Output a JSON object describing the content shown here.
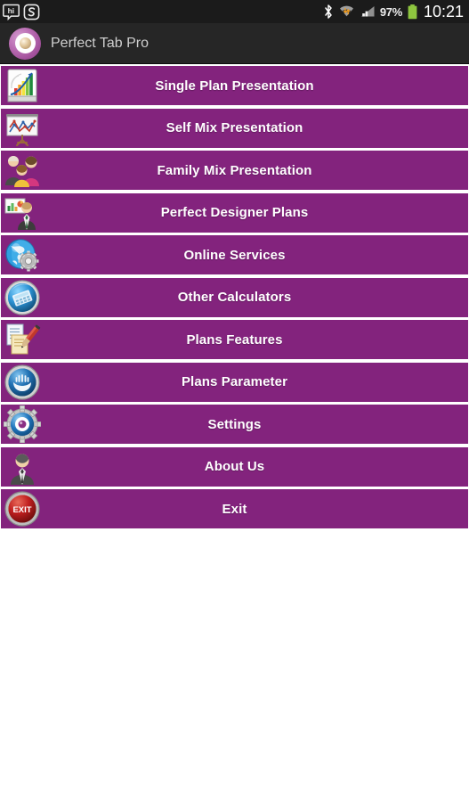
{
  "statusbar": {
    "left_icons": [
      {
        "name": "hike-messenger-icon",
        "label": "hi"
      },
      {
        "name": "notification-app-icon",
        "label": "S"
      }
    ],
    "right_icons": [
      {
        "name": "bluetooth-icon"
      },
      {
        "name": "wifi-icon"
      },
      {
        "name": "cellular-signal-icon"
      }
    ],
    "battery_percent": "97%",
    "battery_color": "#8ec63f",
    "clock": "10:21"
  },
  "titlebar": {
    "app_name": "Perfect Tab Pro",
    "logo_name": "app-logo-icon"
  },
  "theme": {
    "accent_purple": "#83237d",
    "statusbar_bg": "#1b1b1b",
    "titlebar_bg": "#262626",
    "page_bg": "#ffffff",
    "label_color": "#ffffff"
  },
  "menu": {
    "items": [
      {
        "label": "Single Plan Presentation",
        "icon": "chart-card-icon"
      },
      {
        "label": "Self Mix Presentation",
        "icon": "presentation-board-icon"
      },
      {
        "label": "Family Mix Presentation",
        "icon": "family-group-icon"
      },
      {
        "label": "Perfect Designer Plans",
        "icon": "businessman-chart-icon"
      },
      {
        "label": "Online Services",
        "icon": "globe-gear-icon"
      },
      {
        "label": "Other Calculators",
        "icon": "calculator-circle-icon"
      },
      {
        "label": "Plans Features",
        "icon": "documents-pen-icon"
      },
      {
        "label": "Plans Parameter",
        "icon": "hands-circle-icon"
      },
      {
        "label": "Settings",
        "icon": "gear-eye-icon"
      },
      {
        "label": "About Us",
        "icon": "person-avatar-icon"
      },
      {
        "label": "Exit",
        "icon": "exit-button-icon"
      }
    ]
  }
}
